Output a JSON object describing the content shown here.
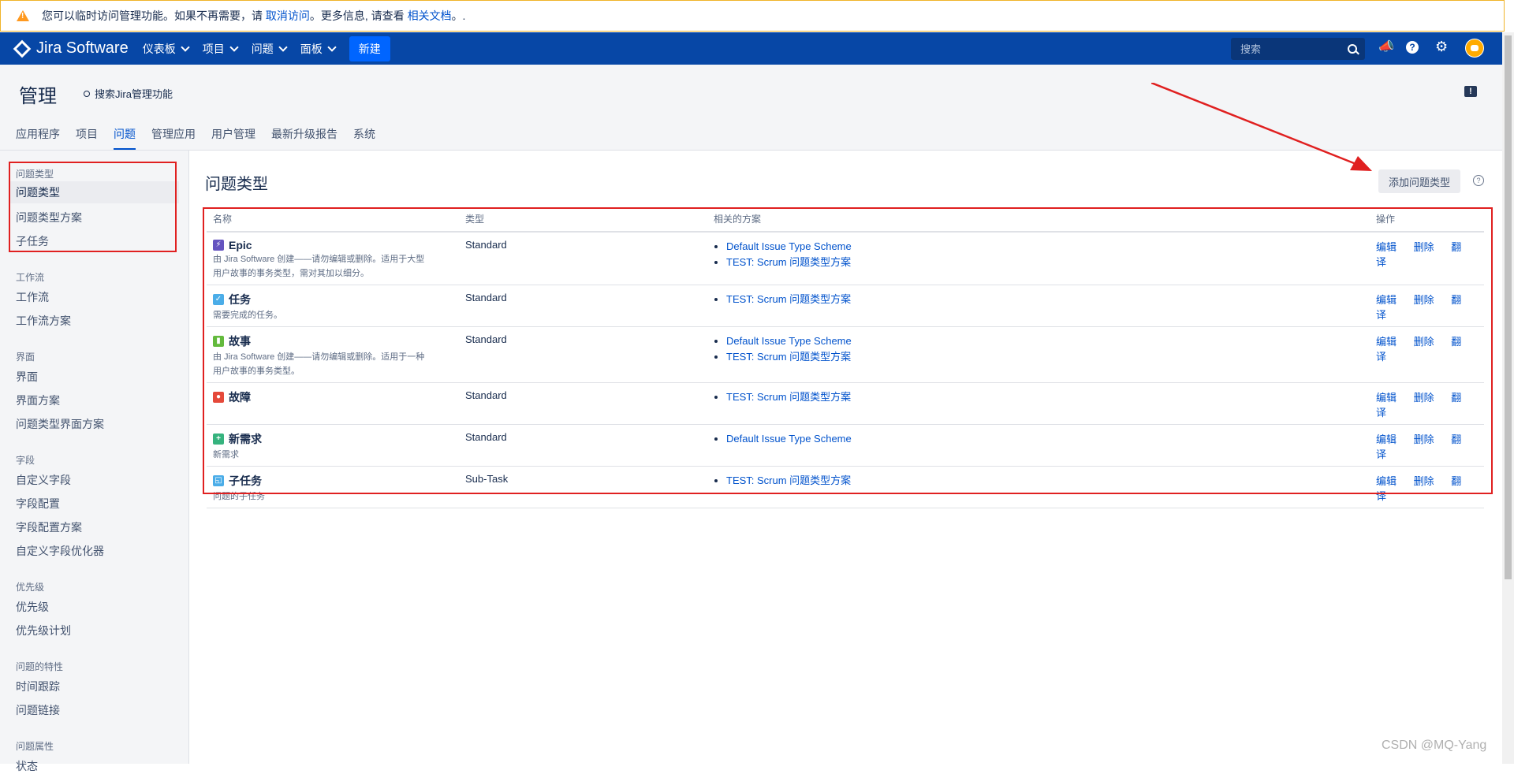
{
  "banner": {
    "text1": "您可以临时访问管理功能。如果不再需要，请 ",
    "link1": "取消访问",
    "text2": "。更多信息, 请查看 ",
    "link2": "相关文档",
    "text3": "。."
  },
  "topnav": {
    "app_name": "Jira Software",
    "items": [
      "仪表板",
      "项目",
      "问题",
      "面板"
    ],
    "create_label": "新建",
    "search_placeholder": "搜索",
    "help_glyph": "?"
  },
  "admin": {
    "title": "管理",
    "search_label": "搜索Jira管理功能",
    "feedback_glyph": "!",
    "tabs": [
      "应用程序",
      "项目",
      "问题",
      "管理应用",
      "用户管理",
      "最新升级报告",
      "系统"
    ],
    "active_tab": "问题"
  },
  "sidebar": {
    "groups": [
      {
        "title": "问题类型",
        "items": [
          "问题类型",
          "问题类型方案",
          "子任务"
        ]
      },
      {
        "title": "工作流",
        "items": [
          "工作流",
          "工作流方案"
        ]
      },
      {
        "title": "界面",
        "items": [
          "界面",
          "界面方案",
          "问题类型界面方案"
        ]
      },
      {
        "title": "字段",
        "items": [
          "自定义字段",
          "字段配置",
          "字段配置方案",
          "自定义字段优化器"
        ]
      },
      {
        "title": "优先级",
        "items": [
          "优先级",
          "优先级计划"
        ]
      },
      {
        "title": "问题的特性",
        "items": [
          "时间跟踪",
          "问题链接"
        ]
      },
      {
        "title": "问题属性",
        "items": [
          "状态"
        ]
      }
    ]
  },
  "page": {
    "title": "问题类型",
    "add_button": "添加问题类型",
    "help_glyph": "?"
  },
  "table": {
    "headers": [
      "名称",
      "类型",
      "相关的方案",
      "操作"
    ],
    "actions": [
      "编辑",
      "删除",
      "翻译"
    ],
    "rows": [
      {
        "name": "Epic",
        "icon": "lightning-icon",
        "icon_color": "#6554c0",
        "desc_lines": [
          "由 Jira Software 创建——请勿编辑或删除。适用于大型",
          "用户故事的事务类型，需对其加以细分。"
        ],
        "type": "Standard",
        "schemes": [
          "Default Issue Type Scheme",
          "TEST: Scrum 问题类型方案"
        ]
      },
      {
        "name": "任务",
        "icon": "checkbox-icon",
        "icon_color": "#4bade8",
        "desc_lines": [
          "需要完成的任务。"
        ],
        "type": "Standard",
        "schemes": [
          "TEST: Scrum 问题类型方案"
        ]
      },
      {
        "name": "故事",
        "icon": "bookmark-icon",
        "icon_color": "#63ba3c",
        "desc_lines": [
          "由 Jira Software 创建——请勿编辑或删除。适用于一种",
          "用户故事的事务类型。"
        ],
        "type": "Standard",
        "schemes": [
          "Default Issue Type Scheme",
          "TEST: Scrum 问题类型方案"
        ]
      },
      {
        "name": "故障",
        "icon": "bug-icon",
        "icon_color": "#e5493a",
        "desc_lines": [],
        "type": "Standard",
        "schemes": [
          "TEST: Scrum 问题类型方案"
        ]
      },
      {
        "name": "新需求",
        "icon": "plus-icon",
        "icon_color": "#36b37e",
        "desc_lines": [
          "新需求"
        ],
        "type": "Standard",
        "schemes": [
          "Default Issue Type Scheme"
        ]
      },
      {
        "name": "子任务",
        "icon": "subtask-icon",
        "icon_color": "#4bade8",
        "desc_lines": [
          "问题的子任务"
        ],
        "type": "Sub-Task",
        "schemes": [
          "TEST: Scrum 问题类型方案"
        ]
      }
    ]
  },
  "watermark": "CSDN @MQ-Yang"
}
